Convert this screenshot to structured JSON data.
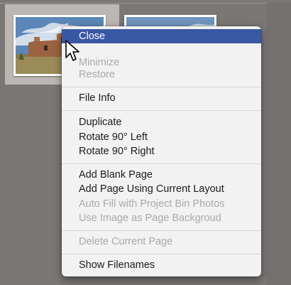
{
  "context_menu": {
    "items": [
      {
        "label": "Close",
        "state": "highlighted"
      },
      {
        "label": "Minimize",
        "state": "disabled"
      },
      {
        "label": "Restore",
        "state": "disabled"
      },
      {
        "label": "File Info",
        "state": "enabled"
      },
      {
        "label": "Duplicate",
        "state": "enabled"
      },
      {
        "label": "Rotate 90° Left",
        "state": "enabled"
      },
      {
        "label": "Rotate 90° Right",
        "state": "enabled"
      },
      {
        "label": "Add Blank Page",
        "state": "enabled"
      },
      {
        "label": "Add Page Using Current Layout",
        "state": "enabled"
      },
      {
        "label": "Auto Fill with Project Bin Photos",
        "state": "disabled"
      },
      {
        "label": "Use Image as Page Backgroud",
        "state": "disabled"
      },
      {
        "label": "Delete Current Page",
        "state": "disabled"
      },
      {
        "label": "Show Filenames",
        "state": "enabled"
      }
    ],
    "highlight_color": "#3857a5",
    "disabled_text_color": "#a9a9a9"
  },
  "project_bin": {
    "thumbnails": [
      {
        "name": "adobe-building-photo",
        "selected": true
      },
      {
        "name": "sky-landscape-photo",
        "selected": false
      }
    ]
  },
  "cursor": {
    "icon": "arrow-pointer-icon"
  }
}
